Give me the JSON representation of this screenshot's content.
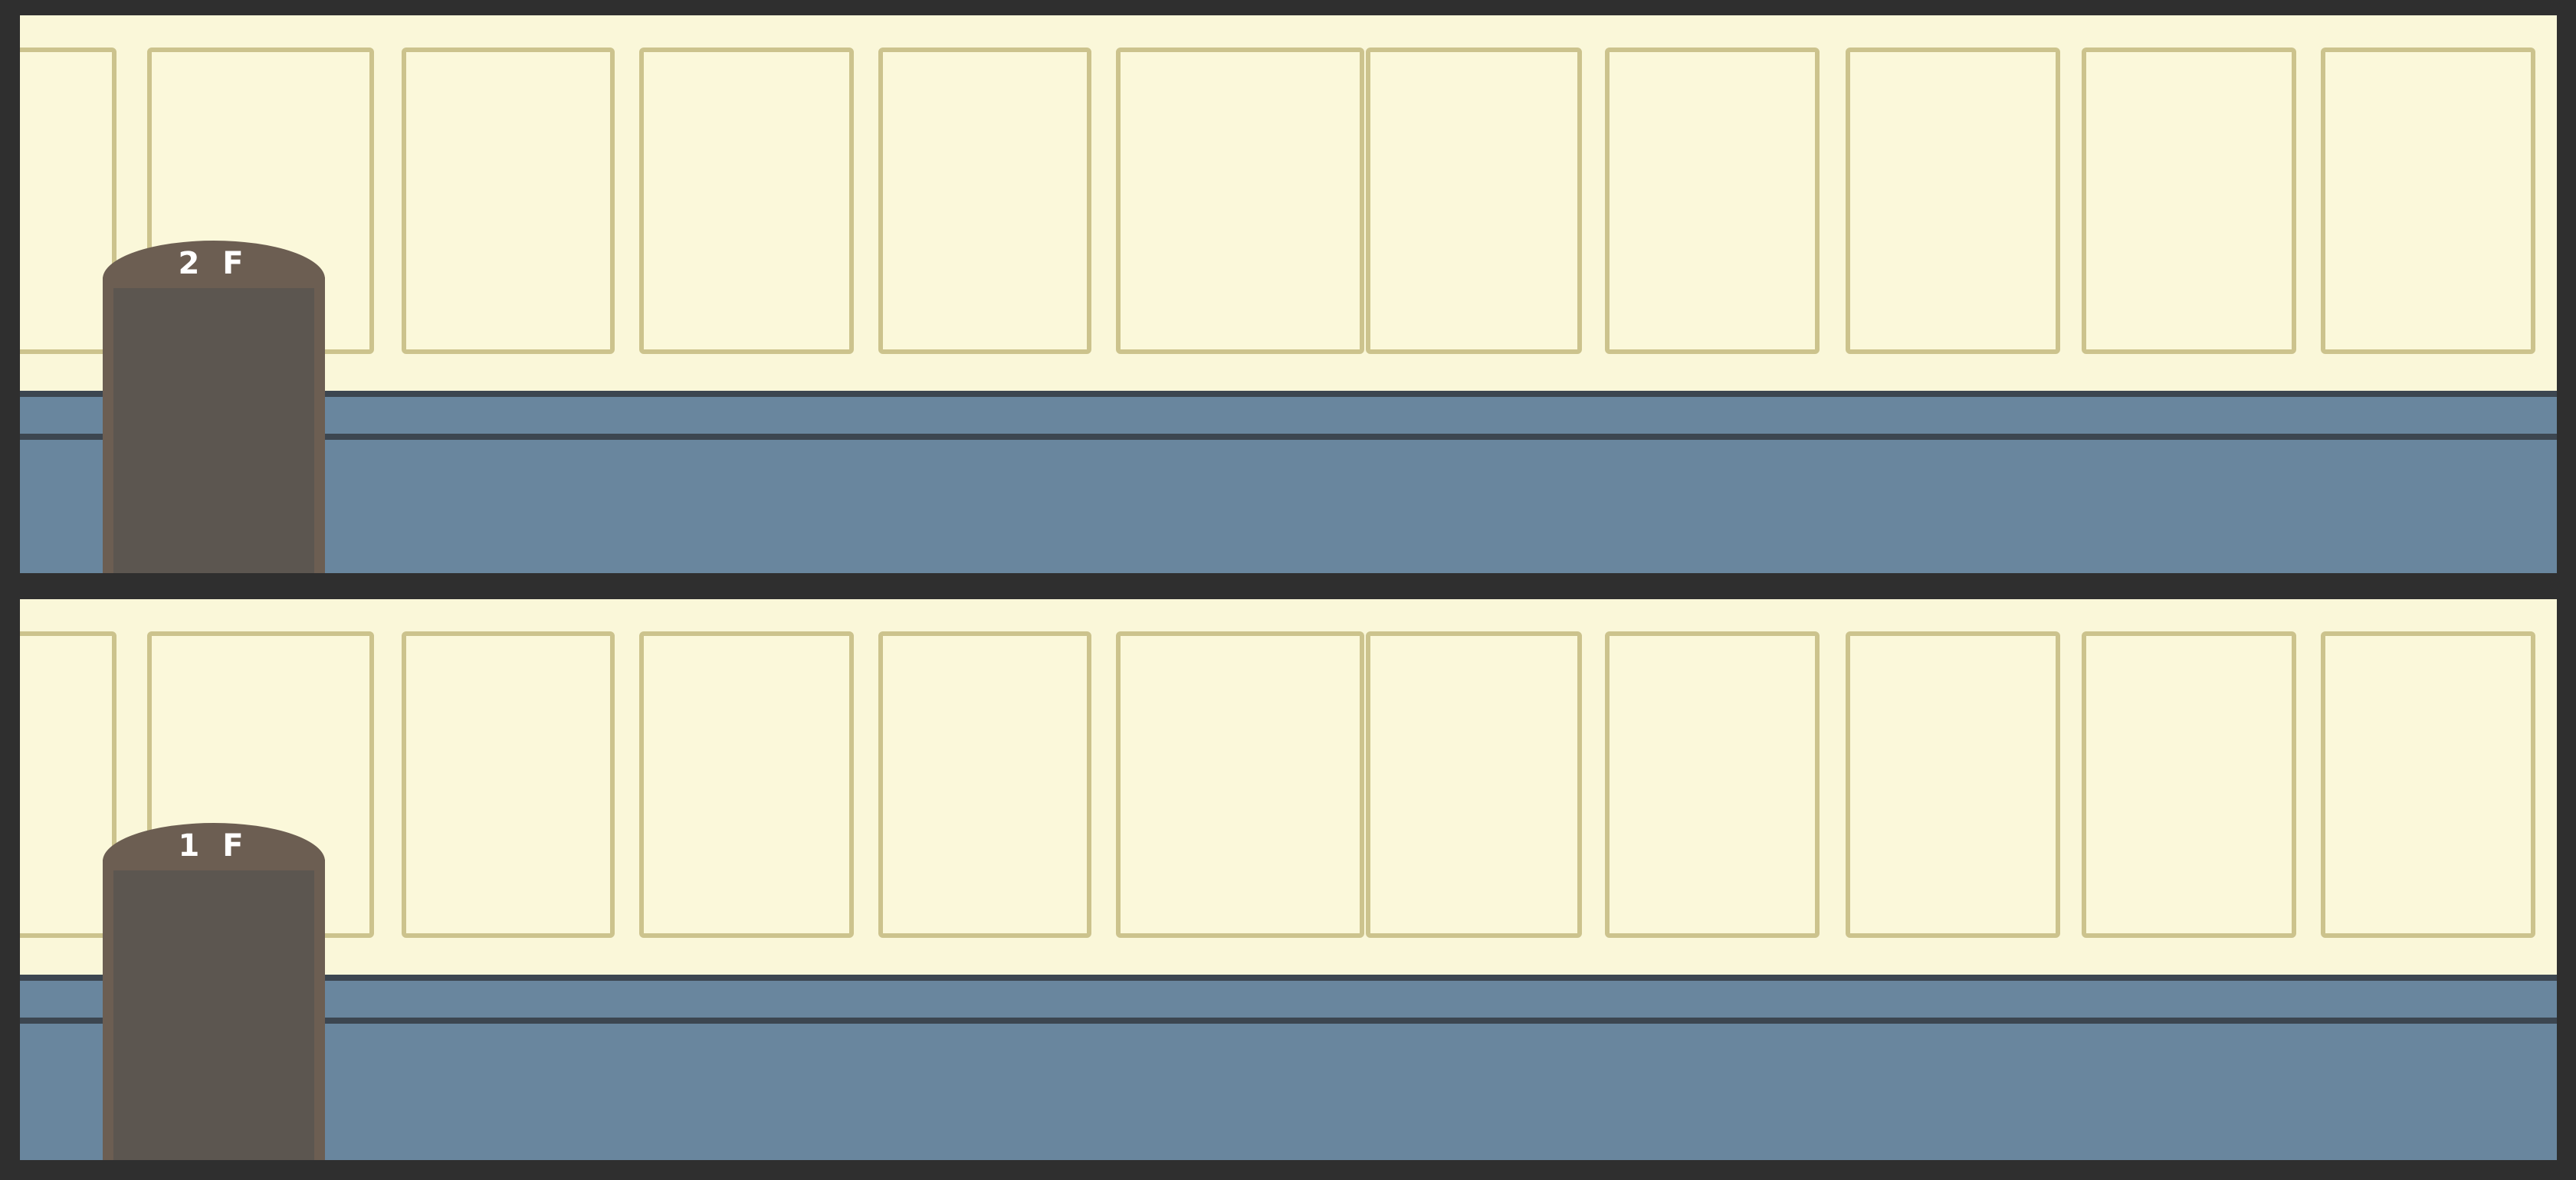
{
  "floors": [
    {
      "label": "2 F"
    },
    {
      "label": "1 F"
    }
  ],
  "colors": {
    "frame": "#2f2f2f",
    "wall": "#faf7d9",
    "panel_border": "#ccc38d",
    "wainscot": "#69869e",
    "trim": "#3c4650",
    "door_frame": "#6c5e52",
    "door_inner": "#5c5650",
    "label_text": "#ffffff"
  }
}
